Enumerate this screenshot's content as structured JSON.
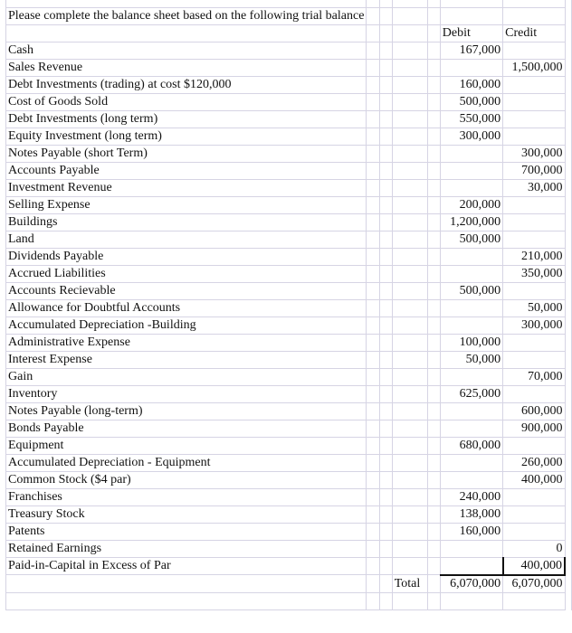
{
  "title": "Please complete the balance sheet based on the following trial balance",
  "headers": {
    "debit": "Debit",
    "credit": "Credit"
  },
  "rows": [
    {
      "account": "Cash",
      "debit": "167,000",
      "credit": ""
    },
    {
      "account": "Sales Revenue",
      "debit": "",
      "credit": "1,500,000"
    },
    {
      "account": "Debt Investments (trading) at cost $120,000",
      "debit": "160,000",
      "credit": ""
    },
    {
      "account": "Cost of Goods Sold",
      "debit": "500,000",
      "credit": ""
    },
    {
      "account": "Debt Investments (long term)",
      "debit": "550,000",
      "credit": ""
    },
    {
      "account": "Equity Investment (long term)",
      "debit": "300,000",
      "credit": ""
    },
    {
      "account": "Notes Payable (short Term)",
      "debit": "",
      "credit": "300,000"
    },
    {
      "account": "Accounts Payable",
      "debit": "",
      "credit": "700,000"
    },
    {
      "account": "Investment Revenue",
      "debit": "",
      "credit": "30,000"
    },
    {
      "account": "Selling Expense",
      "debit": "200,000",
      "credit": ""
    },
    {
      "account": "Buildings",
      "debit": "1,200,000",
      "credit": ""
    },
    {
      "account": "Land",
      "debit": "500,000",
      "credit": ""
    },
    {
      "account": "Dividends Payable",
      "debit": "",
      "credit": "210,000"
    },
    {
      "account": "Accrued Liabilities",
      "debit": "",
      "credit": "350,000"
    },
    {
      "account": "Accounts Recievable",
      "debit": "500,000",
      "credit": ""
    },
    {
      "account": "Allowance for Doubtful Accounts",
      "debit": "",
      "credit": "50,000"
    },
    {
      "account": "Accumulated Depreciation -Building",
      "debit": "",
      "credit": "300,000"
    },
    {
      "account": "Administrative Expense",
      "debit": "100,000",
      "credit": ""
    },
    {
      "account": "Interest Expense",
      "debit": "50,000",
      "credit": ""
    },
    {
      "account": "Gain",
      "debit": "",
      "credit": "70,000"
    },
    {
      "account": "Inventory",
      "debit": "625,000",
      "credit": ""
    },
    {
      "account": "Notes Payable (long-term)",
      "debit": "",
      "credit": "600,000"
    },
    {
      "account": "Bonds Payable",
      "debit": "",
      "credit": "900,000"
    },
    {
      "account": "Equipment",
      "debit": "680,000",
      "credit": ""
    },
    {
      "account": "Accumulated Depreciation - Equipment",
      "debit": "",
      "credit": "260,000"
    },
    {
      "account": "Common Stock ($4  par)",
      "debit": "",
      "credit": "400,000"
    },
    {
      "account": "Franchises",
      "debit": "240,000",
      "credit": ""
    },
    {
      "account": "Treasury Stock",
      "debit": "138,000",
      "credit": ""
    },
    {
      "account": "Patents",
      "debit": "160,000",
      "credit": ""
    },
    {
      "account": "Retained Earnings",
      "debit": "",
      "credit": "0"
    },
    {
      "account": "Paid-in-Capital in Excess of Par",
      "debit": "",
      "credit": "400,000"
    }
  ],
  "total": {
    "label": "Total",
    "debit": "6,070,000",
    "credit": "6,070,000"
  }
}
